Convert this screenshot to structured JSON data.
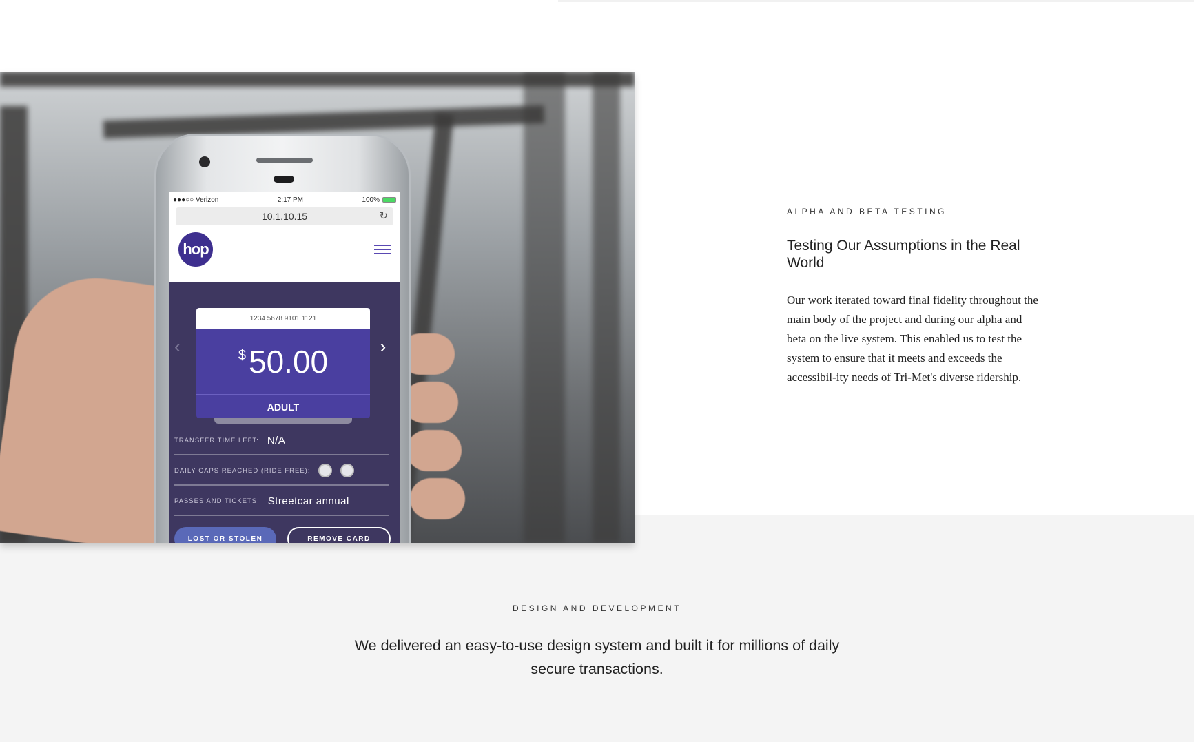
{
  "phone_screen": {
    "status": {
      "carrier": "●●●○○ Verizon",
      "time": "2:17 PM",
      "battery": "100%"
    },
    "url": "10.1.10.15",
    "logo_text": "hop",
    "card": {
      "number": "1234 5678 9101 1121",
      "currency": "$",
      "amount": "50.00",
      "type": "ADULT"
    },
    "rows": [
      {
        "label": "Transfer time left:",
        "value": "N/A"
      },
      {
        "label": "Daily caps reached (ride free):",
        "value": ""
      },
      {
        "label": "Passes and tickets:",
        "value": "Streetcar annual"
      }
    ],
    "buttons": {
      "lost": "LOST OR STOLEN",
      "remove": "REMOVE CARD"
    }
  },
  "section_testing": {
    "eyebrow": "ALPHA AND BETA TESTING",
    "heading": "Testing Our Assumptions in the Real World",
    "body": "Our work iterated toward final fidelity throughout the main body of the project and during our alpha and beta on the live system. This enabled us to test the system to ensure that it meets and exceeds the accessibil-ity needs of Tri-Met's diverse ridership."
  },
  "section_design": {
    "eyebrow": "DESIGN AND DEVELOPMENT",
    "statement": "We delivered an easy-to-use design system and built it for millions of daily secure transactions."
  },
  "colors": {
    "band_gray": "#f4f4f4",
    "app_purple": "#3e3760",
    "card_purple": "#4a3fa0",
    "logo_purple": "#3e2f8f"
  },
  "icons": [
    "reload-icon",
    "menu-icon",
    "chevron-left-icon",
    "chevron-right-icon",
    "bus-icon",
    "streetcar-icon",
    "wifi-icon"
  ]
}
